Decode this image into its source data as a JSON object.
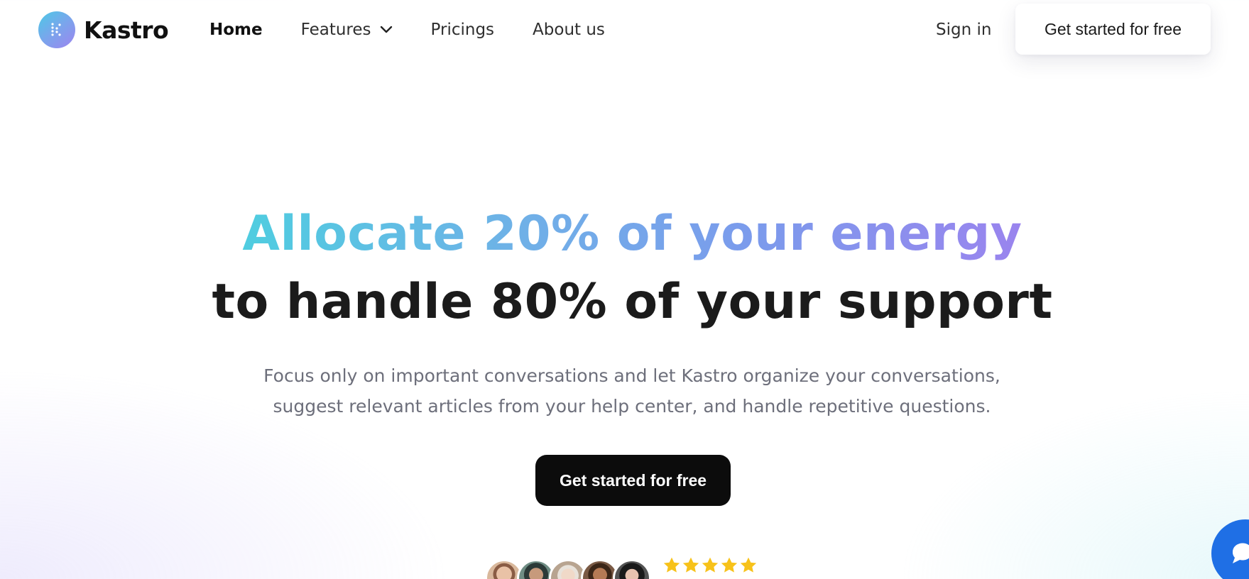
{
  "brand": {
    "name": "Kastro",
    "logo_icon": "kastro-logo-icon",
    "gradient_start": "#4cc9e6",
    "gradient_end": "#9d84ef"
  },
  "nav": {
    "items": [
      {
        "label": "Home"
      },
      {
        "label": "Features",
        "icon": "chevron-down-icon"
      },
      {
        "label": "Pricings"
      },
      {
        "label": "About us"
      }
    ],
    "active": "Home",
    "signin_label": "Sign in",
    "cta_label": "Get started for free"
  },
  "hero": {
    "headline_highlight": "Allocate 20% of your energy",
    "headline_rest": "to handle 80% of your support",
    "subtitle": "Focus only on important conversations and let Kastro organize your conversations, suggest relevant articles from your help center, and handle repetitive questions.",
    "cta_label": "Get started for free",
    "cta_color": "#0c0c0c"
  },
  "social_proof": {
    "rating_stars": 5,
    "star_color": "#f7c21a",
    "avatar_count": 5
  },
  "chat_widget": {
    "icon": "chat-icon",
    "color": "#1f6fe5"
  }
}
